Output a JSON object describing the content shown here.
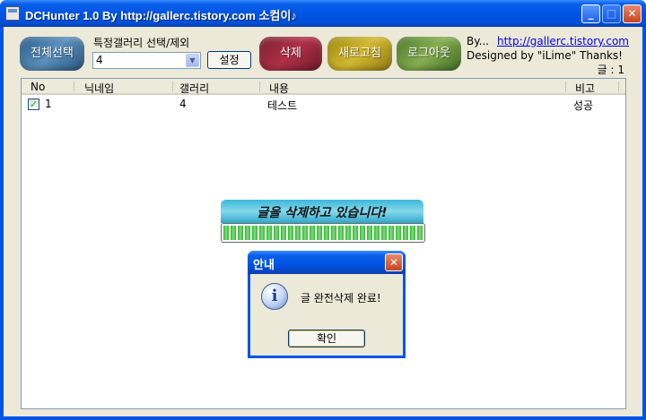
{
  "window": {
    "title": "DCHunter 1.0 By http://gallerc.tistory.com 소컴이♪",
    "minimize_glyph": "_",
    "maximize_glyph": "□",
    "close_glyph": "✕"
  },
  "toolbar": {
    "select_all_label": "전체선택",
    "gallery_label": "특정갤러리 선택/제외",
    "gallery_value": "4",
    "set_label": "설정",
    "delete_label": "삭제",
    "refresh_label": "새로고침",
    "logout_label": "로그아웃"
  },
  "credits": {
    "by": "By...",
    "link": "http://gallerc.tistory.com",
    "designed": "Designed by \"iLime\" Thanks!",
    "count": "글 : 1"
  },
  "list": {
    "columns": [
      "No",
      "닉네임",
      "갤러리",
      "내용",
      "비고"
    ],
    "rows": [
      {
        "checked": true,
        "no": "1",
        "nickname": "",
        "gallery": "4",
        "content": "테스트",
        "note": "성공"
      }
    ]
  },
  "progress": {
    "banner_text": "글을 삭제하고 있습니다!",
    "fraction": 1.0
  },
  "dialog": {
    "title": "안내",
    "message": "글 완전삭제 완료!",
    "ok_label": "확인",
    "close_glyph": "✕"
  },
  "colors": {
    "titlebar": "#0054e3",
    "face": "#ece9d8",
    "link": "#0000ee",
    "progress": "#2fb62f"
  }
}
